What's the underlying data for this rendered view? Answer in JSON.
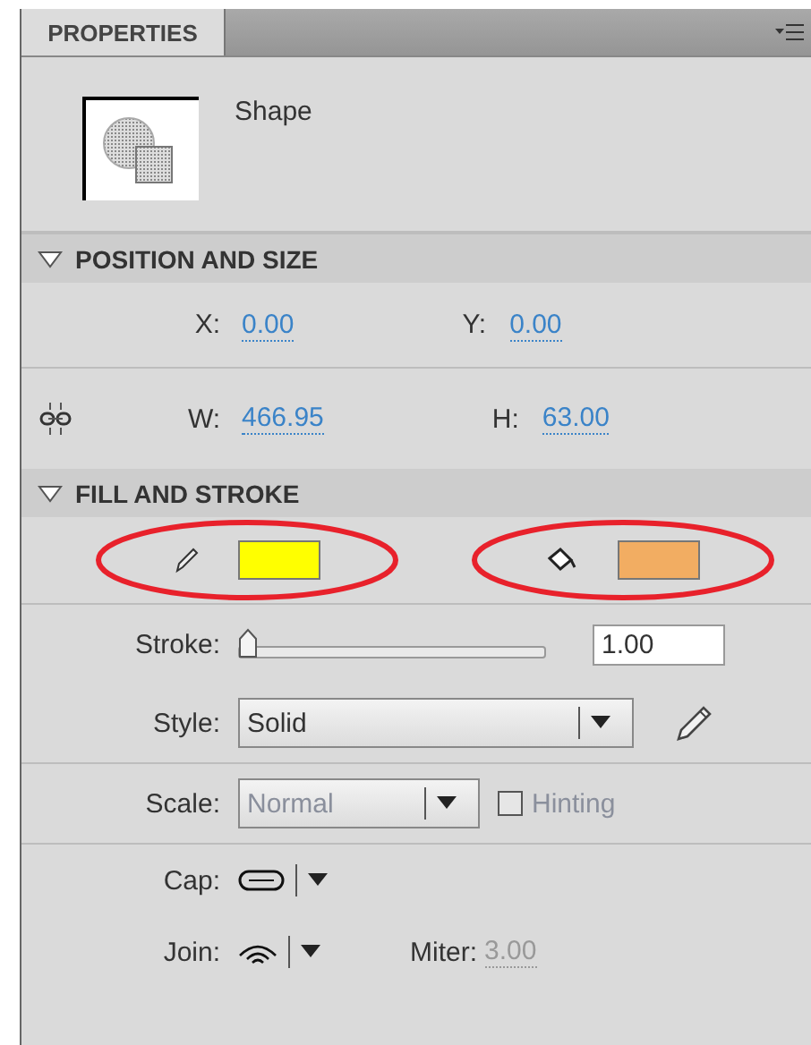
{
  "tab": {
    "label": "PROPERTIES",
    "selected": true
  },
  "object": {
    "name": "Shape"
  },
  "position_and_size": {
    "title": "POSITION AND SIZE",
    "expanded": true,
    "fields": [
      {
        "label": "X:",
        "value": "0.00"
      },
      {
        "label": "Y:",
        "value": "0.00"
      },
      {
        "label": "W:",
        "value": "466.95"
      },
      {
        "label": "H:",
        "value": "63.00"
      }
    ]
  },
  "fill_and_stroke": {
    "title": "FILL AND STROKE",
    "expanded": true,
    "swatches": [
      {
        "kind": "stroke",
        "color": "#ffff00",
        "highlighted": true
      },
      {
        "kind": "fill",
        "color": "#f2ad62",
        "highlighted": true
      }
    ],
    "stroke": {
      "label": "Stroke:",
      "level": 0,
      "value": "1.00"
    },
    "style": {
      "label": "Style:",
      "value": "Solid"
    },
    "scale": {
      "label": "Scale:",
      "value": "Normal",
      "disabled": true
    },
    "hinting": {
      "label": "Hinting",
      "checked": false,
      "disabled": true
    },
    "cap": {
      "label": "Cap:"
    },
    "join": {
      "label": "Join:"
    },
    "miter": {
      "label": "Miter:",
      "value": "3.00",
      "disabled": true
    }
  }
}
